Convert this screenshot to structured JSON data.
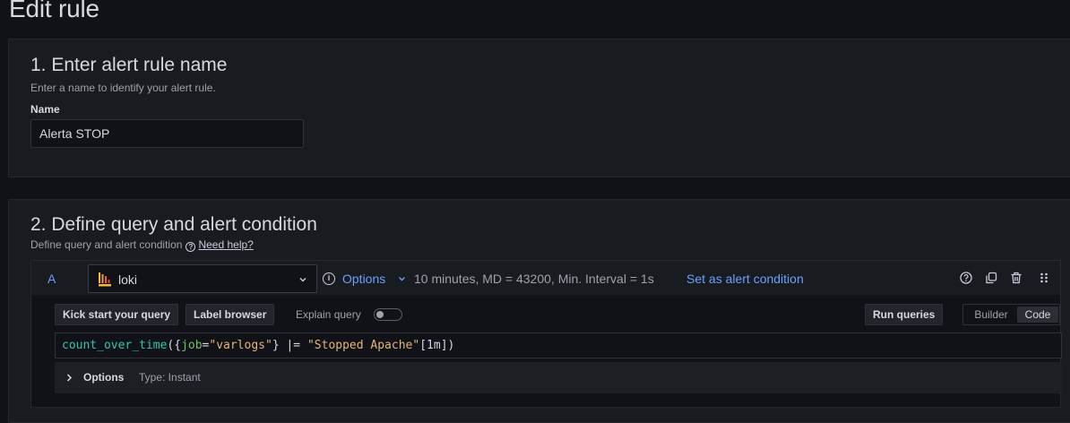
{
  "page": {
    "title": "Edit rule"
  },
  "section1": {
    "title": "1. Enter alert rule name",
    "description": "Enter a name to identify your alert rule.",
    "name_label": "Name",
    "name_value": "Alerta STOP"
  },
  "section2": {
    "title": "2. Define query and alert condition",
    "description": "Define query and alert condition",
    "help_link": "Need help?",
    "query": {
      "ref_id": "A",
      "datasource": "loki",
      "options_label": "Options",
      "meta": "10 minutes, MD = 43200, Min. Interval = 1s",
      "alert_condition_link": "Set as alert condition",
      "buttons": {
        "kick_start": "Kick start your query",
        "label_browser": "Label browser",
        "run_queries": "Run queries"
      },
      "explain_query_label": "Explain query",
      "explain_query_enabled": false,
      "editor_modes": [
        "Builder",
        "Code"
      ],
      "editor_mode_selected": "Code",
      "expression_tokens": {
        "fn": "count_over_time",
        "open": "({",
        "label_key": "job",
        "eq": "=",
        "label_value": "\"varlogs\"",
        "close_sel": "} |= ",
        "filter": "\"Stopped Apache\"",
        "range_open": "[",
        "range": "1m",
        "range_close": "])"
      },
      "options_bar": {
        "label": "Options",
        "type": "Type: Instant"
      }
    }
  },
  "colors": {
    "background": "#111217",
    "panel": "#181b1f",
    "link": "#6e9fff",
    "text": "#d8d9e0",
    "muted": "#9fa1ab"
  },
  "icons": [
    "loki-logo-icon",
    "chevron-down-icon",
    "info-icon",
    "help-icon",
    "copy-icon",
    "trash-icon",
    "drag-handle-icon",
    "chevron-right-icon"
  ]
}
